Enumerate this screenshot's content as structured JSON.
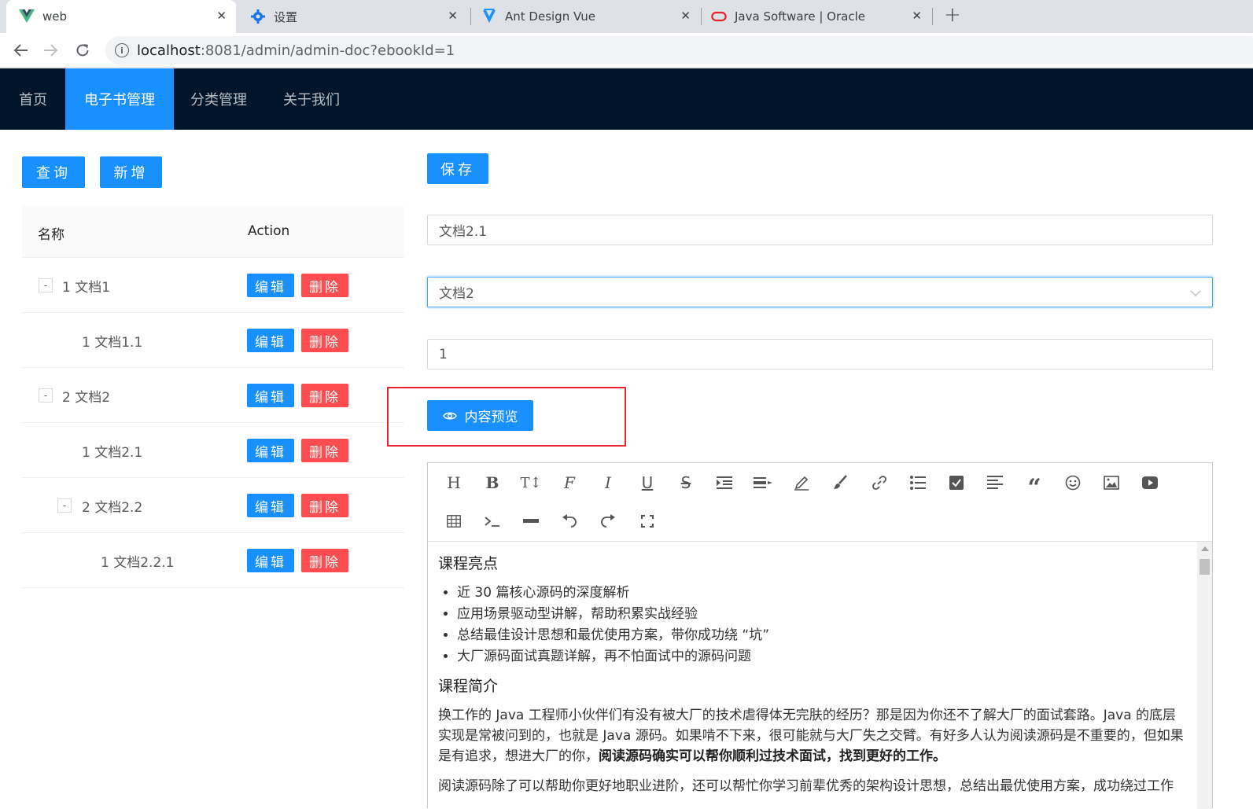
{
  "browser": {
    "tabs": [
      {
        "title": "web",
        "icon": "vue-logo-icon"
      },
      {
        "title": "设置",
        "icon": "gear-icon"
      },
      {
        "title": "Ant Design Vue",
        "icon": "ant-design-vue-icon"
      },
      {
        "title": "Java Software | Oracle",
        "icon": "oracle-icon"
      }
    ],
    "close_glyph": "✕",
    "new_tab": "+",
    "url_host": "localhost",
    "url_rest": ":8081/admin/admin-doc?ebookId=1"
  },
  "nav": {
    "items": [
      "首页",
      "电子书管理",
      "分类管理",
      "关于我们"
    ],
    "selected": "电子书管理",
    "color_selected": "#1890ff",
    "color_bg": "#001529"
  },
  "left": {
    "query_label": "查询",
    "add_label": "新增",
    "columns": {
      "name": "名称",
      "action": "Action"
    },
    "edit_label": "编辑",
    "delete_label": "删除",
    "expander_glyph": "-",
    "rows": [
      {
        "name": "1 文档1",
        "level": 0,
        "expandable": true
      },
      {
        "name": "1 文档1.1",
        "level": 1,
        "expandable": false
      },
      {
        "name": "2 文档2",
        "level": 0,
        "expandable": true
      },
      {
        "name": "1 文档2.1",
        "level": 1,
        "expandable": false
      },
      {
        "name": "2 文档2.2",
        "level": 1,
        "expandable": true
      },
      {
        "name": "1 文档2.2.1",
        "level": 2,
        "expandable": false
      }
    ]
  },
  "form": {
    "save_label": "保存",
    "name_value": "文档2.1",
    "parent_value": "文档2",
    "sort_value": "1",
    "preview_label": "内容预览"
  },
  "editor": {
    "toolbar_row1": [
      "header-icon",
      "bold-icon",
      "font-size-icon",
      "font-name-icon",
      "italic-icon",
      "underline-icon",
      "strikethrough-icon",
      "indent-icon",
      "line-height-icon",
      "fore-color-icon",
      "back-color-icon",
      "link-icon",
      "list-icon",
      "todo-icon",
      "justify-icon",
      "quote-icon",
      "emoticon-icon",
      "image-icon",
      "video-icon"
    ],
    "toolbar_row2": [
      "table-icon",
      "code-icon",
      "splitline-icon",
      "undo-icon",
      "redo-icon",
      "fullscreen-icon"
    ],
    "heading1": "课程亮点",
    "bullets": [
      "近 30 篇核心源码的深度解析",
      "应用场景驱动型讲解，帮助积累实战经验",
      "总结最佳设计思想和最优使用方案，带你成功绕 “坑”",
      "大厂源码面试真题详解，再不怕面试中的源码问题"
    ],
    "heading2": "课程简介",
    "para1": "换工作的 Java 工程师小伙伴们有没有被大厂的技术虐得体无完肤的经历？那是因为你还不了解大厂的面试套路。Java 的底层实现是常被问到的，也就是 Java 源码。如果啃不下来，很可能就与大厂失之交臂。有好多人认为阅读源码是不重要的，但如果是有追求，想进大厂的你，",
    "para1_bold": "阅读源码确实可以帮你顺利过技术面试，找到更好的工作。",
    "para2": "阅读源码除了可以帮助你更好地职业进阶，还可以帮忙你学习前辈优秀的架构设计思想，总结出最优使用方案，成功绕过工作"
  }
}
